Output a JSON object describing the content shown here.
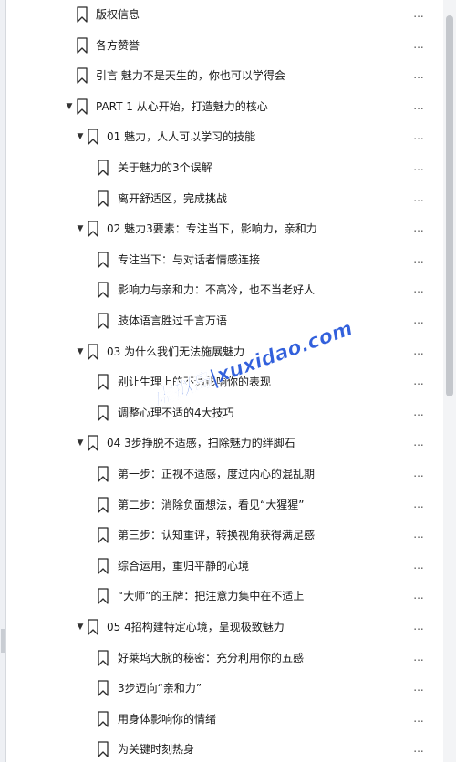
{
  "outline": {
    "items": [
      {
        "level": 0,
        "expanded": null,
        "label": "版权信息"
      },
      {
        "level": 0,
        "expanded": null,
        "label": "各方赞誉"
      },
      {
        "level": 0,
        "expanded": null,
        "label": "引言 魅力不是天生的，你也可以学得会"
      },
      {
        "level": 0,
        "expanded": true,
        "label": "PART 1 从心开始，打造魅力的核心"
      },
      {
        "level": 1,
        "expanded": true,
        "label": "01 魅力，人人可以学习的技能"
      },
      {
        "level": 2,
        "expanded": null,
        "label": "关于魅力的3个误解"
      },
      {
        "level": 2,
        "expanded": null,
        "label": "离开舒适区，完成挑战"
      },
      {
        "level": 1,
        "expanded": true,
        "label": "02 魅力3要素：专注当下，影响力，亲和力"
      },
      {
        "level": 2,
        "expanded": null,
        "label": "专注当下：与对话者情感连接"
      },
      {
        "level": 2,
        "expanded": null,
        "label": "影响力与亲和力：不高冷，也不当老好人"
      },
      {
        "level": 2,
        "expanded": null,
        "label": "肢体语言胜过千言万语"
      },
      {
        "level": 1,
        "expanded": true,
        "label": "03 为什么我们无法施展魅力"
      },
      {
        "level": 2,
        "expanded": null,
        "label": "别让生理上的不适影响你的表现"
      },
      {
        "level": 2,
        "expanded": null,
        "label": "调整心理不适的4大技巧"
      },
      {
        "level": 1,
        "expanded": true,
        "label": "04 3步挣脱不适感，扫除魅力的绊脚石"
      },
      {
        "level": 2,
        "expanded": null,
        "label": "第一步：正视不适感，度过内心的混乱期"
      },
      {
        "level": 2,
        "expanded": null,
        "label": "第二步：消除负面想法，看见“大猩猩”"
      },
      {
        "level": 2,
        "expanded": null,
        "label": "第三步：认知重评，转换视角获得满足感"
      },
      {
        "level": 2,
        "expanded": null,
        "label": "综合运用，重归平静的心境"
      },
      {
        "level": 2,
        "expanded": null,
        "label": "“大师”的王牌：把注意力集中在不适上"
      },
      {
        "level": 1,
        "expanded": true,
        "label": "05 4招构建特定心境，呈现极致魅力"
      },
      {
        "level": 2,
        "expanded": null,
        "label": "好莱坞大腕的秘密：充分利用你的五感"
      },
      {
        "level": 2,
        "expanded": null,
        "label": "3步迈向“亲和力”"
      },
      {
        "level": 2,
        "expanded": null,
        "label": "用身体影响你的情绪"
      },
      {
        "level": 2,
        "expanded": null,
        "label": "为关键时刻热身"
      }
    ],
    "more_label": "..."
  },
  "watermark": {
    "text": "虚拟岛|xuxidao.com",
    "color": "#1c4fd8"
  },
  "scrollbar": {
    "thumb_fraction_top": 0.02,
    "thumb_fraction_size": 0.5
  }
}
